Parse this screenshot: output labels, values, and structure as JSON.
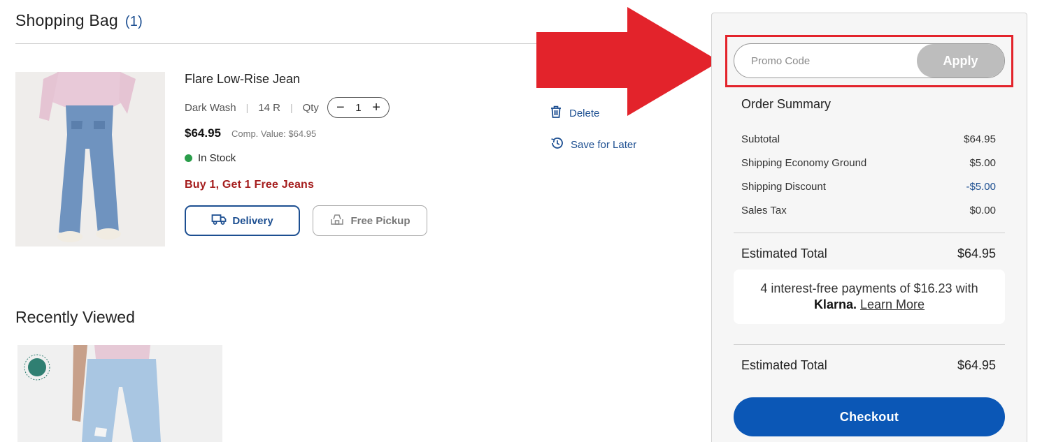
{
  "bag": {
    "title": "Shopping Bag",
    "count": "(1)"
  },
  "item": {
    "name": "Flare Low-Rise Jean",
    "color": "Dark Wash",
    "size": "14 R",
    "qty_label": "Qty",
    "qty": "1",
    "price": "$64.95",
    "comp_value": "Comp. Value: $64.95",
    "stock": "In Stock",
    "promo": "Buy 1, Get 1 Free Jeans",
    "delivery_label": "Delivery",
    "pickup_label": "Free Pickup",
    "delete_label": "Delete",
    "save_label": "Save for Later"
  },
  "recently_viewed": {
    "title": "Recently Viewed"
  },
  "summary": {
    "promo_placeholder": "Promo Code",
    "apply_label": "Apply",
    "title": "Order Summary",
    "rows": [
      {
        "label": "Subtotal",
        "value": "$64.95"
      },
      {
        "label": "Shipping Economy Ground",
        "value": "$5.00"
      },
      {
        "label": "Shipping Discount",
        "value": "-$5.00"
      },
      {
        "label": "Sales Tax",
        "value": "$0.00"
      }
    ],
    "estimated_label": "Estimated Total",
    "estimated_value": "$64.95",
    "klarna_text": "4 interest-free payments of $16.23 with",
    "klarna_brand": "Klarna.",
    "klarna_link": "Learn More",
    "estimated_label_2": "Estimated Total",
    "estimated_value_2": "$64.95",
    "checkout_label": "Checkout"
  },
  "colors": {
    "accent_blue": "#1d4f91",
    "checkout_blue": "#0b57b6",
    "promo_red": "#a51d1d",
    "annotation_red": "#e3232b",
    "stock_green": "#2a9d4a"
  },
  "icons": [
    "truck-icon",
    "store-pickup-icon",
    "trash-icon",
    "save-later-icon",
    "red-arrow-annotation"
  ]
}
